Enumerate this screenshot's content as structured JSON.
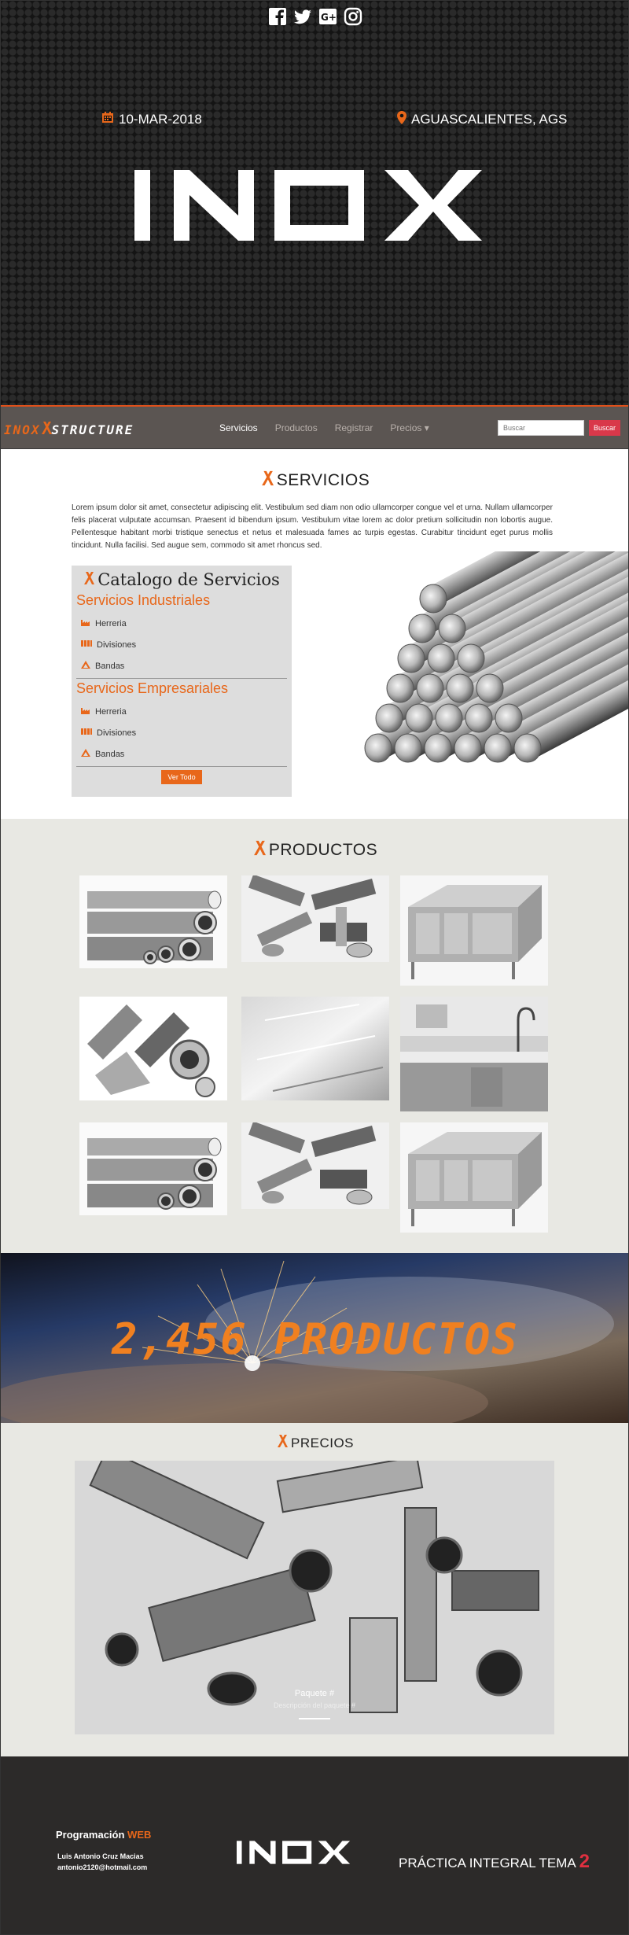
{
  "hero": {
    "date": "10-MAR-2018",
    "location": "AGUASCALIENTES, AGS",
    "logo_text": "INOX",
    "social": [
      "facebook-icon",
      "twitter-icon",
      "google-plus-icon",
      "instagram-icon"
    ]
  },
  "navbar": {
    "brand_left": "INOX",
    "brand_right": "STRUCTURE",
    "links": [
      "Servicios",
      "Productos",
      "Registrar",
      "Precios"
    ],
    "search_placeholder": "Buscar",
    "search_button": "Buscar"
  },
  "servicios": {
    "title": "SERVICIOS",
    "text": "Lorem ipsum dolor sit amet, consectetur adipiscing elit. Vestibulum sed diam non odio ullamcorper congue vel et urna. Nullam ullamcorper felis placerat vulputate accumsan. Praesent id bibendum ipsum. Vestibulum vitae lorem ac dolor pretium sollicitudin non lobortis augue. Pellentesque habitant morbi tristique senectus et netus et malesuada fames ac turpis egestas. Curabitur tincidunt eget purus mollis tincidunt. Nulla facilisi. Sed augue sem, commodo sit amet rhoncus sed.",
    "catalog_title": "Catalogo de Servicios",
    "groups": [
      {
        "title": "Servicios Industriales",
        "items": [
          "Herreria",
          "Divisiones",
          "Bandas"
        ]
      },
      {
        "title": "Servicios Empresariales",
        "items": [
          "Herreria",
          "Divisiones",
          "Bandas"
        ]
      }
    ],
    "ver_todo": "Ver Todo"
  },
  "productos": {
    "title": "PRODUCTOS"
  },
  "banner": {
    "text": "2,456 PRODUCTOS"
  },
  "precios": {
    "title": "PRECIOS",
    "caption": "Paquete #",
    "subcaption": "Descripción del paquete #"
  },
  "footer": {
    "programacion": "Programación",
    "web": "WEB",
    "name": "Luis Antonio Cruz Macias",
    "email": "antonio2120@hotmail.com",
    "logo_text": "INOX",
    "practica": "PRÁCTICA INTEGRAL TEMA",
    "tema_num": "2"
  },
  "colors": {
    "accent": "#e8671a",
    "nav_bg": "#5b5552",
    "button_red": "#d9384a",
    "footer_bg": "#2c2a29",
    "section_bg": "#e8e8e3"
  }
}
